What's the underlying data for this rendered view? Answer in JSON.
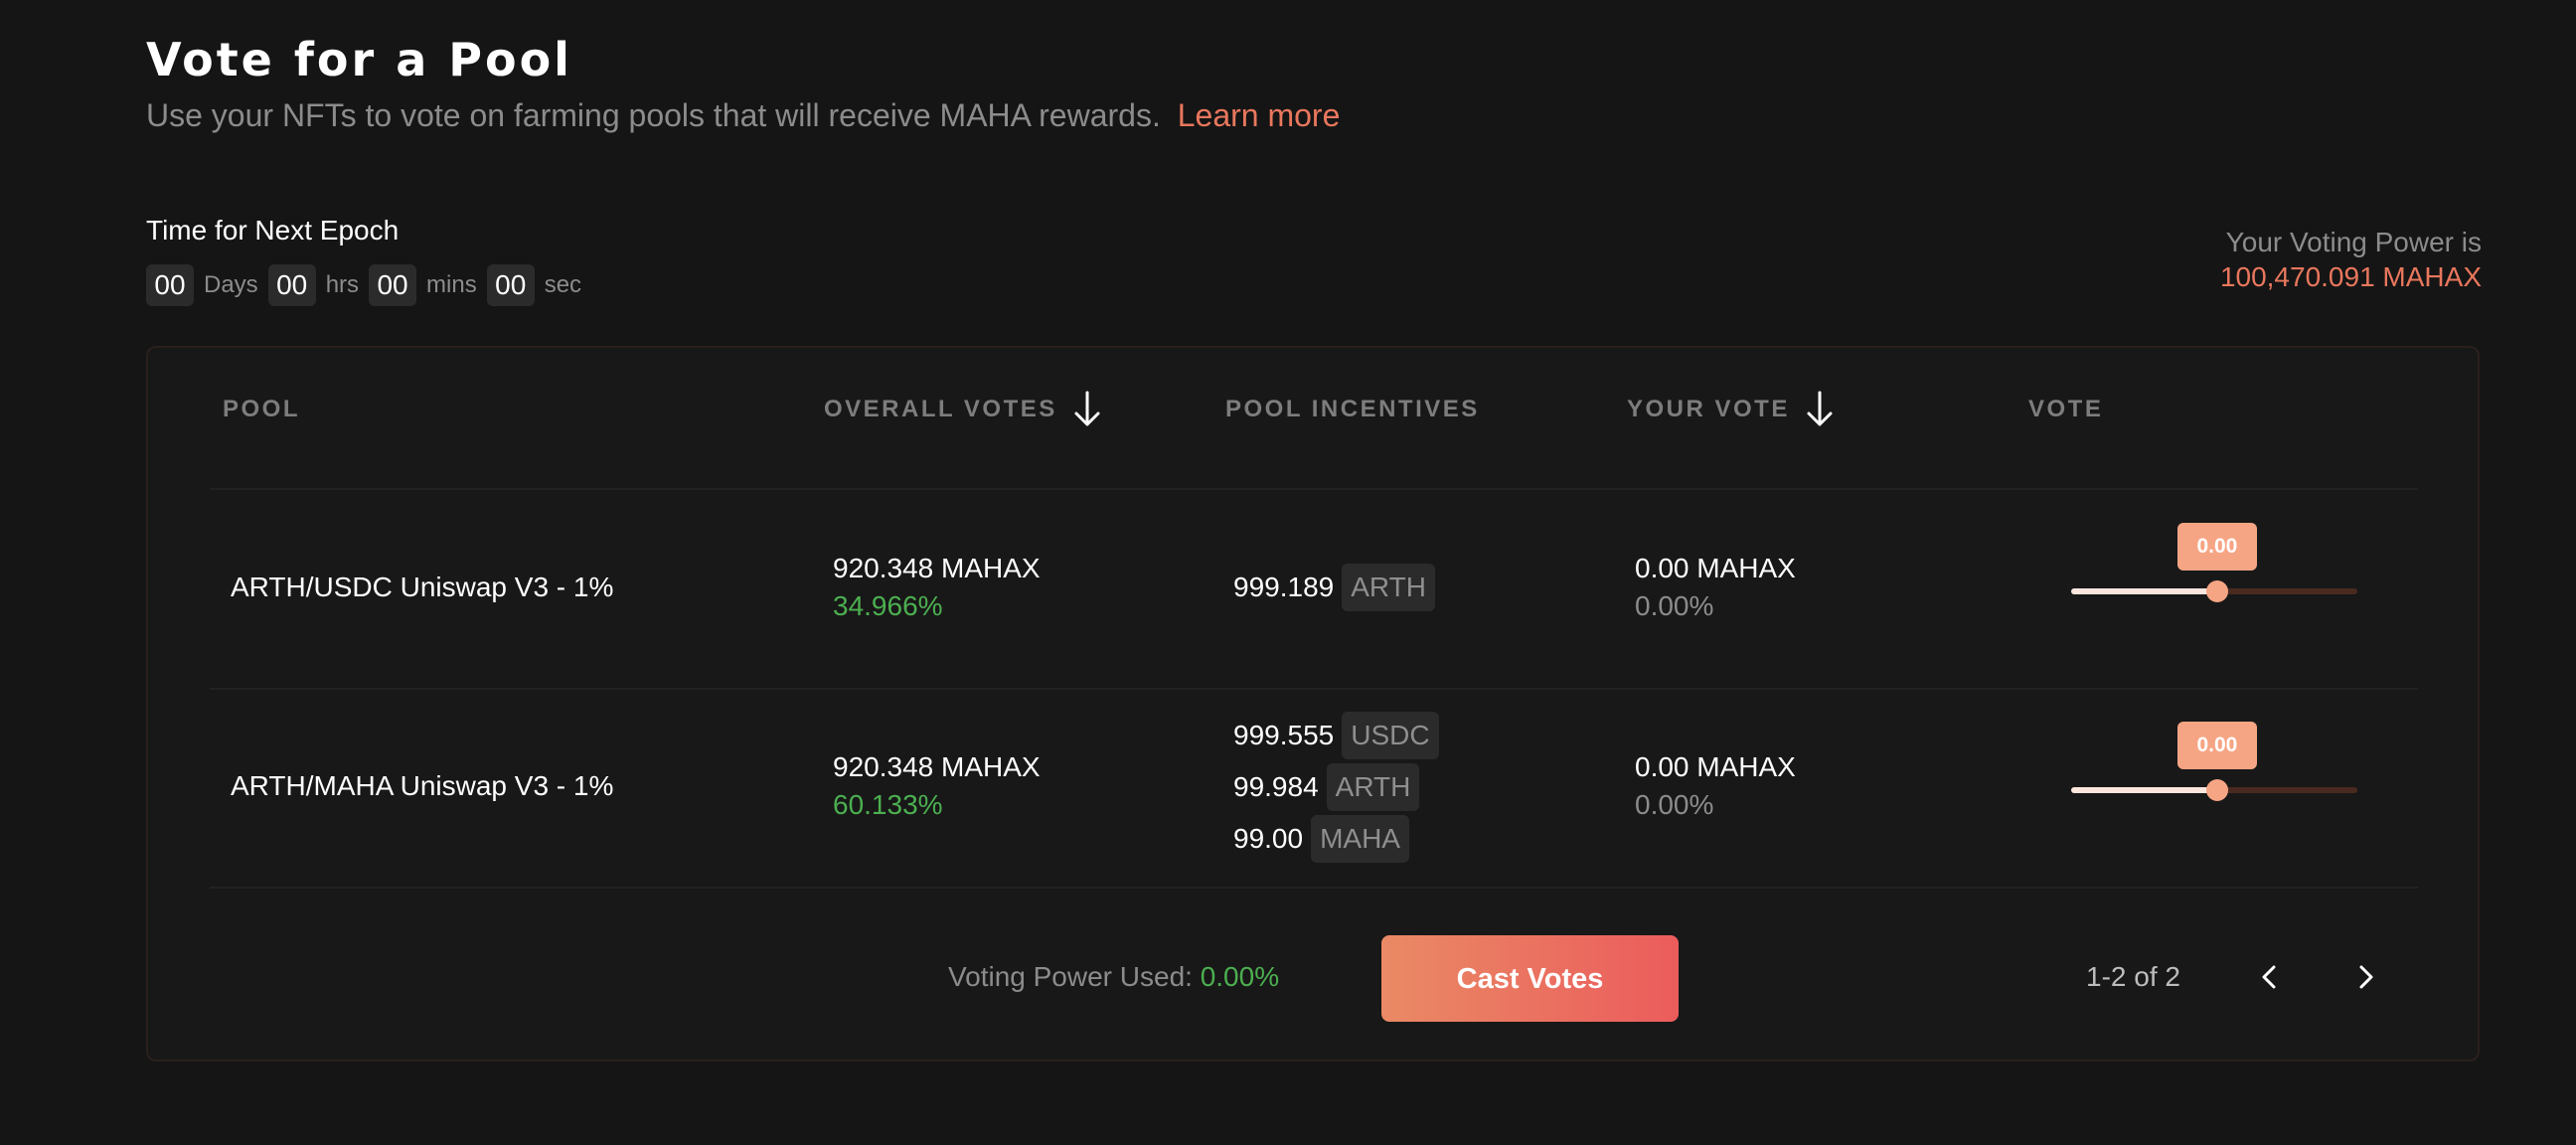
{
  "header": {
    "title": "Vote for a Pool",
    "subtitle": "Use your NFTs to vote on farming pools that will receive MAHA rewards.",
    "learn_more": "Learn more"
  },
  "epoch": {
    "label": "Time for Next Epoch",
    "days": "00",
    "days_unit": "Days",
    "hrs": "00",
    "hrs_unit": "hrs",
    "mins": "00",
    "mins_unit": "mins",
    "sec": "00",
    "sec_unit": "sec"
  },
  "voting_power": {
    "label": "Your Voting Power is",
    "value": "100,470.091 MAHAX"
  },
  "table": {
    "columns": {
      "pool": "POOL",
      "overall_votes": "OVERALL VOTES",
      "pool_incentives": "POOL INCENTIVES",
      "your_vote": "YOUR VOTE",
      "vote": "VOTE"
    },
    "rows": [
      {
        "pool": "ARTH/USDC Uniswap V3 - 1%",
        "overall_votes": "920.348 MAHAX",
        "overall_pct": "34.966%",
        "incentives": [
          {
            "amount": "999.189",
            "token": "ARTH"
          }
        ],
        "your_vote": "0.00 MAHAX",
        "your_pct": "0.00%",
        "slider_label": "0.00",
        "slider_fraction": 0.51
      },
      {
        "pool": "ARTH/MAHA Uniswap V3 - 1%",
        "overall_votes": "920.348 MAHAX",
        "overall_pct": "60.133%",
        "incentives": [
          {
            "amount": "999.555",
            "token": "USDC"
          },
          {
            "amount": "99.984",
            "token": "ARTH"
          },
          {
            "amount": "99.00",
            "token": "MAHA"
          }
        ],
        "your_vote": "0.00 MAHAX",
        "your_pct": "0.00%",
        "slider_label": "0.00",
        "slider_fraction": 0.51
      }
    ]
  },
  "footer": {
    "used_label": "Voting Power Used:",
    "used_value": "0.00%",
    "cast_button": "Cast Votes",
    "pagination": "1-2 of 2"
  },
  "icons": {
    "sort_overall": "arrow-down-icon",
    "sort_your_vote": "arrow-down-icon",
    "prev_page": "chevron-left-icon",
    "next_page": "chevron-right-icon"
  },
  "colors": {
    "background": "#151515",
    "accent": "#e9775d",
    "positive": "#4caf50",
    "slider_thumb": "#f6a584"
  }
}
